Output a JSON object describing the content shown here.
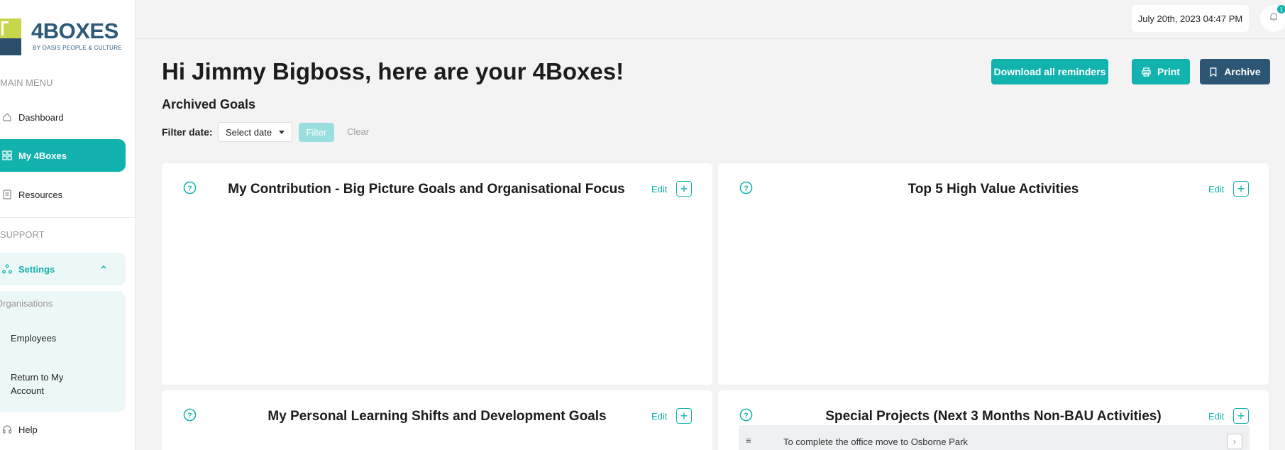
{
  "brand": {
    "name": "4BOXES",
    "tagline": "BY OASIS PEOPLE & CULTURE"
  },
  "sidebar": {
    "main_menu_label": "MAIN MENU",
    "items": [
      {
        "label": "Dashboard",
        "icon": "home-icon"
      },
      {
        "label": "My 4Boxes",
        "icon": "grid-icon",
        "active": true
      },
      {
        "label": "Resources",
        "icon": "document-icon"
      }
    ],
    "support_label": "SUPPORT",
    "settings": {
      "label": "Settings",
      "expanded": true
    },
    "settings_sub": {
      "group_label": "Organisations",
      "items": [
        "Employees",
        "Return to My Account"
      ]
    },
    "help_label": "Help"
  },
  "topbar": {
    "datetime": "July 20th, 2023 04:47 PM",
    "notification_count": "1"
  },
  "header": {
    "greeting": "Hi Jimmy Bigboss, here are your 4Boxes!",
    "subtitle": "Archived Goals",
    "buttons": {
      "download": "Download all reminders",
      "print": "Print",
      "archive": "Archive"
    }
  },
  "filter": {
    "label": "Filter date:",
    "select_value": "Select date",
    "filter_button": "Filter",
    "clear_button": "Clear"
  },
  "cards": [
    {
      "title": "My Contribution - Big Picture Goals and Organisational Focus",
      "edit": "Edit"
    },
    {
      "title": "Top 5 High Value Activities",
      "edit": "Edit"
    },
    {
      "title": "My Personal Learning Shifts and Development Goals",
      "edit": "Edit"
    },
    {
      "title": "Special Projects (Next 3 Months Non-BAU Activities)",
      "edit": "Edit",
      "items": [
        "To complete the office move to Osborne Park"
      ]
    }
  ],
  "colors": {
    "accent": "#12b3ae",
    "navy": "#2d5574",
    "lime": "#c8d64b",
    "background": "#f3f3f3"
  }
}
